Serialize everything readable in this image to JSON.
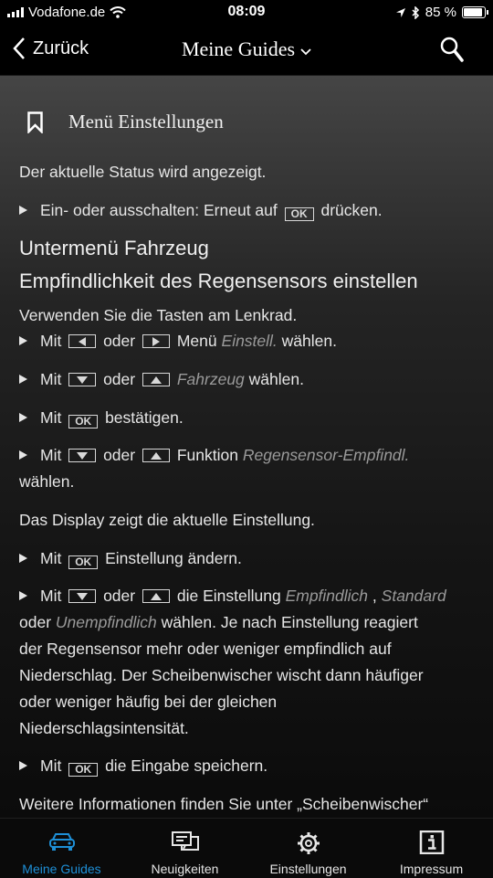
{
  "status": {
    "carrier": "Vodafone.de",
    "time": "08:09",
    "battery": "85 %"
  },
  "nav": {
    "back_label": "Zurück",
    "title": "Meine Guides"
  },
  "section": {
    "title": "Menü Einstellungen"
  },
  "content": {
    "p1": "Der aktuelle Status wird angezeigt.",
    "b1_a": "Ein- oder ausschalten: Erneut auf",
    "b1_b": "drücken.",
    "h_sub": "Untermenü Fahrzeug",
    "h_rain": "Empfindlichkeit des Regensensors einstellen",
    "p2": "Verwenden Sie die Tasten am Lenkrad.",
    "mit": "Mit",
    "oder": "oder",
    "b2_a": "Menü",
    "b2_it": "Einstell.",
    "waehlen": "wählen.",
    "b3_it": "Fahrzeug",
    "b4_a": "bestätigen.",
    "b5_a": "Funktion",
    "b5_it": "Regensensor-Empfindl.",
    "p3": "Das Display zeigt die aktuelle Einstellung.",
    "b6_a": "Einstellung ändern.",
    "b7_a": "die Einstellung",
    "b7_it1": "Empfindlich",
    "comma": ",",
    "b7_it2": "Standard",
    "b7_line2_a": "oder",
    "b7_it3": "Unempfindlich",
    "b7_line2_b": "wählen. Je nach Einstellung reagiert",
    "b7_line3": "der Regensensor mehr oder weniger empfindlich auf",
    "b7_line4": "Niederschlag. Der Scheibenwischer wischt dann häufiger",
    "b7_line5": "oder weniger häufig bei der gleichen",
    "b7_line6": "Niederschlagsintensität.",
    "b8_a": "die Eingabe speichern.",
    "p4": "Weitere Informationen finden Sie unter „Scheibenwischer“",
    "ok_key": "OK"
  },
  "tabs": [
    {
      "label": "Meine Guides",
      "icon": "car-icon",
      "active": true
    },
    {
      "label": "Neuigkeiten",
      "icon": "news-icon",
      "active": false
    },
    {
      "label": "Einstellungen",
      "icon": "gear-icon",
      "active": false
    },
    {
      "label": "Impressum",
      "icon": "info-icon",
      "active": false
    }
  ],
  "colors": {
    "accent": "#1e8fd6",
    "background": "#000000",
    "italic_text": "#9a9a9a"
  }
}
